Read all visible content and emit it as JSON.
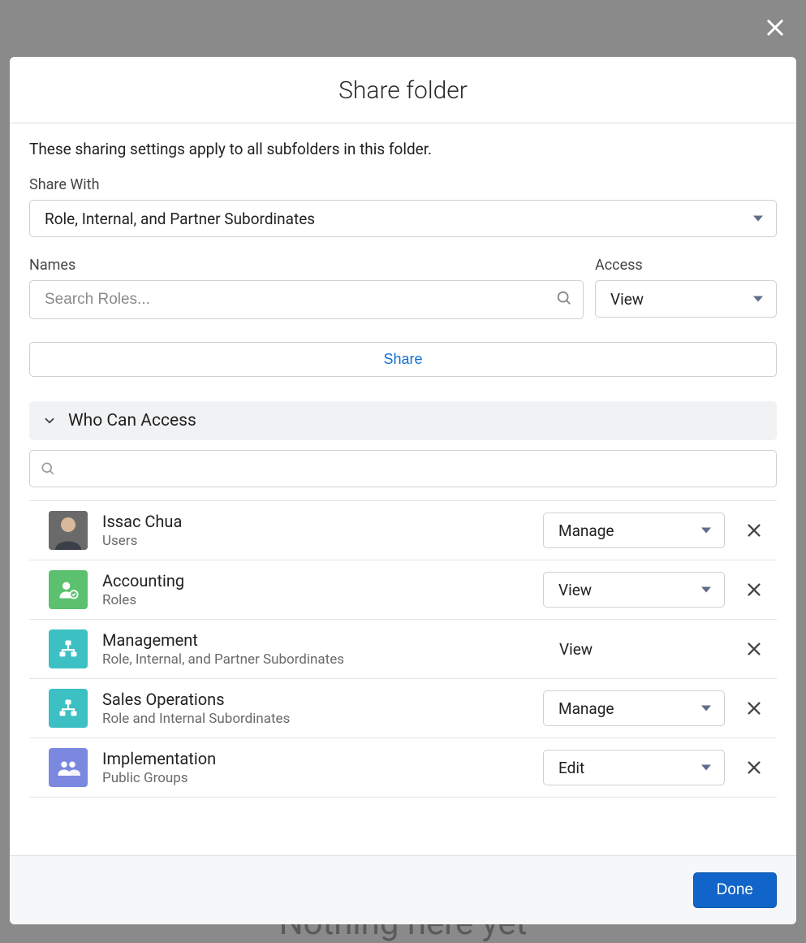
{
  "background_text": "Nothing here yet",
  "modal": {
    "title": "Share folder",
    "description": "These sharing settings apply to all subfolders in this folder.",
    "share_with_label": "Share With",
    "share_with_value": "Role, Internal, and Partner Subordinates",
    "names_label": "Names",
    "names_placeholder": "Search Roles...",
    "access_label": "Access",
    "access_value": "View",
    "share_button": "Share",
    "who_can_access_title": "Who Can Access",
    "filter_placeholder": "",
    "done_button": "Done"
  },
  "entries": [
    {
      "name": "Issac Chua",
      "type": "Users",
      "access": "Manage",
      "access_editable": true,
      "icon": "avatar"
    },
    {
      "name": "Accounting",
      "type": "Roles",
      "access": "View",
      "access_editable": true,
      "icon": "role"
    },
    {
      "name": "Management",
      "type": "Role, Internal, and Partner Subordinates",
      "access": "View",
      "access_editable": false,
      "icon": "hierarchy"
    },
    {
      "name": "Sales Operations",
      "type": "Role and Internal Subordinates",
      "access": "Manage",
      "access_editable": true,
      "icon": "hierarchy"
    },
    {
      "name": "Implementation",
      "type": "Public Groups",
      "access": "Edit",
      "access_editable": true,
      "icon": "group"
    }
  ]
}
